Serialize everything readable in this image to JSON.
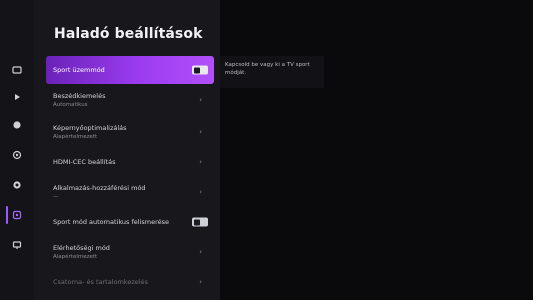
{
  "title": "Haladó beállítások",
  "help": {
    "text": "Kapcsold be vagy ki a TV sport módját."
  },
  "items": [
    {
      "label": "Sport üzemmód",
      "sub": "",
      "control": "toggle-on",
      "selected": true
    },
    {
      "label": "Beszédkiemelés",
      "sub": "Automatikus",
      "control": "chevron",
      "selected": false
    },
    {
      "label": "Képernyőoptimalizálás",
      "sub": "Alapértelmezett",
      "control": "chevron",
      "selected": false
    },
    {
      "label": "HDMI-CEC beállítás",
      "sub": "",
      "control": "chevron",
      "selected": false
    },
    {
      "label": "Alkalmazás-hozzáférési mód",
      "sub": "—",
      "control": "chevron",
      "selected": false
    },
    {
      "label": "Sport mód automatikus felismerése",
      "sub": "",
      "control": "toggle-off",
      "selected": false
    },
    {
      "label": "Elérhetőségi mód",
      "sub": "Alapértelmezett",
      "control": "chevron",
      "selected": false
    },
    {
      "label": "Csatorna- és tartalomkezelés",
      "sub": "",
      "control": "chevron",
      "selected": false,
      "dim": true
    }
  ],
  "rail": [
    {
      "icon": "input-source-icon"
    },
    {
      "icon": "play-icon"
    },
    {
      "icon": "globe-icon"
    },
    {
      "icon": "sound-icon"
    },
    {
      "icon": "network-icon"
    },
    {
      "icon": "advanced-settings-icon",
      "active": true
    },
    {
      "icon": "display-icon"
    }
  ],
  "colors": {
    "accent": "#9b3cf0",
    "background": "#0a0a0c"
  }
}
